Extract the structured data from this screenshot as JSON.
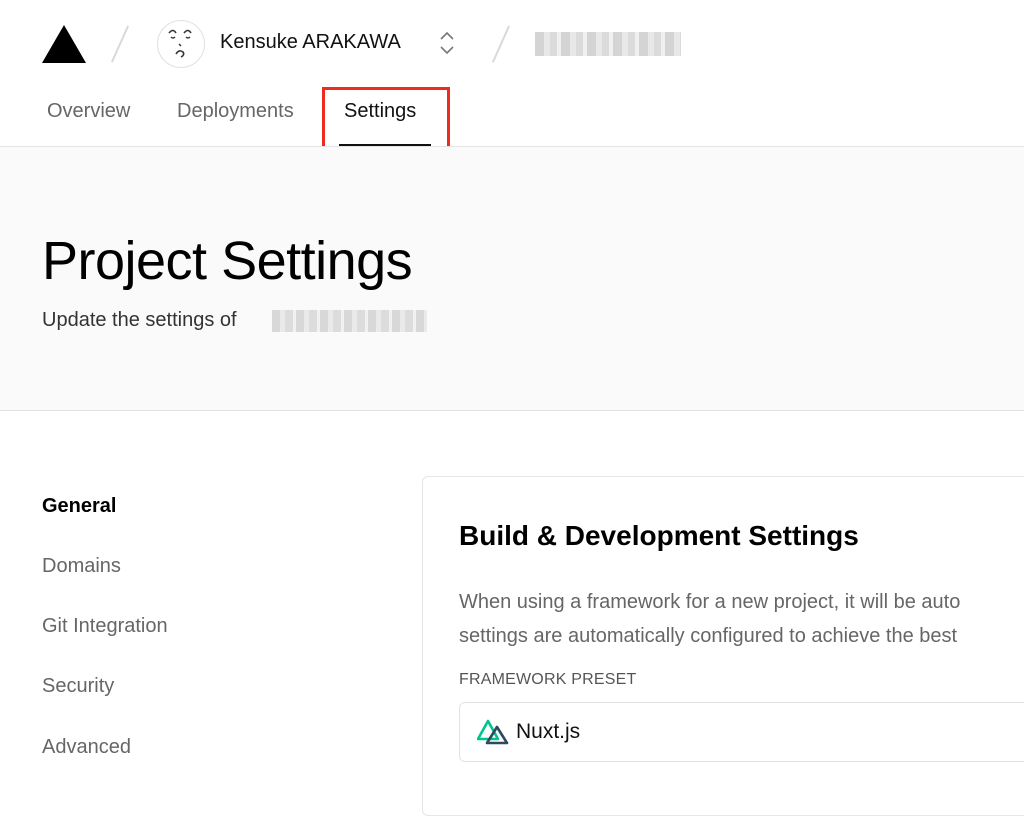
{
  "header": {
    "user_name": "Kensuke ARAKAWA",
    "tabs": [
      {
        "label": "Overview"
      },
      {
        "label": "Deployments"
      },
      {
        "label": "Settings"
      }
    ]
  },
  "hero": {
    "title": "Project Settings",
    "subtitle": "Update the settings of"
  },
  "sidebar": {
    "items": [
      {
        "label": "General"
      },
      {
        "label": "Domains"
      },
      {
        "label": "Git Integration"
      },
      {
        "label": "Security"
      },
      {
        "label": "Advanced"
      }
    ]
  },
  "build_settings": {
    "title": "Build & Development Settings",
    "description_line1": "When using a framework for a new project, it will be auto",
    "description_line2": "settings are automatically configured to achieve the best",
    "framework_label": "FRAMEWORK PRESET",
    "framework_value": "Nuxt.js"
  },
  "colors": {
    "highlight": "#ee2b1c",
    "nuxt_green": "#00c58e",
    "nuxt_dark": "#2f495e"
  },
  "icons": {
    "logo": "triangle-logo-icon",
    "switcher": "chevron-up-down-icon",
    "framework": "nuxt-logo-icon"
  }
}
